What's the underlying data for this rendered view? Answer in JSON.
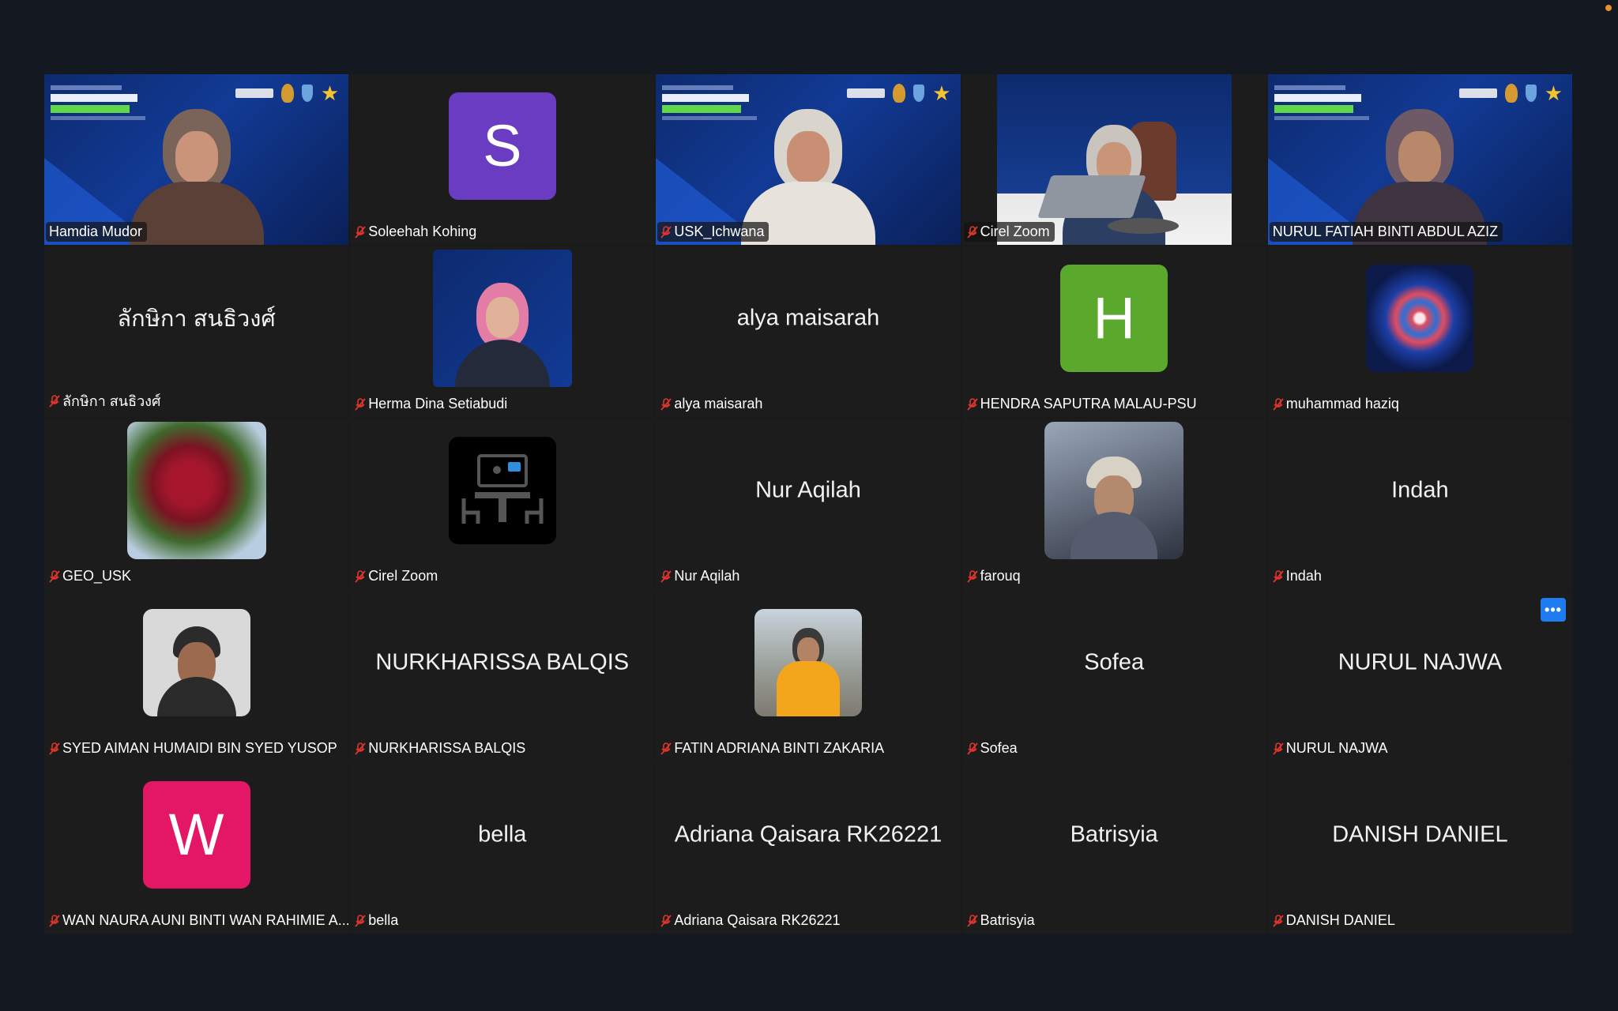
{
  "colors": {
    "active_border": "#23d160",
    "mic_muted": "#e0352b",
    "more_button": "#1e7cf0",
    "avatar_purple": "#6a3cc1",
    "avatar_green": "#5ba92c",
    "avatar_pink": "#e31765"
  },
  "tiles": [
    {
      "label": "Hamdia Mudor"
    },
    {
      "label": "Soleehah Kohing",
      "avatar_letter": "S"
    },
    {
      "label": "USK_Ichwana"
    },
    {
      "label": "Cirel Zoom"
    },
    {
      "label": "NURUL FATIAH BINTI ABDUL AZIZ"
    },
    {
      "label": "ลักษิกา สนธิวงศ์",
      "display_name": "ลักษิกา สนธิวงศ์"
    },
    {
      "label": "Herma Dina Setiabudi"
    },
    {
      "label": "alya maisarah",
      "display_name": "alya maisarah"
    },
    {
      "label": "HENDRA SAPUTRA MALAU-PSU",
      "avatar_letter": "H"
    },
    {
      "label": "muhammad haziq"
    },
    {
      "label": "GEO_USK"
    },
    {
      "label": "Cirel Zoom"
    },
    {
      "label": "Nur Aqilah",
      "display_name": "Nur Aqilah"
    },
    {
      "label": "farouq"
    },
    {
      "label": "Indah",
      "display_name": "Indah"
    },
    {
      "label": "SYED AIMAN HUMAIDI BIN SYED YUSOP"
    },
    {
      "label": "NURKHARISSA BALQIS",
      "display_name": "NURKHARISSA BALQIS"
    },
    {
      "label": "FATIN ADRIANA BINTI ZAKARIA"
    },
    {
      "label": "Sofea",
      "display_name": "Sofea"
    },
    {
      "label": "NURUL NAJWA",
      "display_name": "NURUL NAJWA"
    },
    {
      "label": "WAN NAURA AUNI BINTI WAN RAHIMIE A...",
      "avatar_letter": "W"
    },
    {
      "label": "bella",
      "display_name": "bella"
    },
    {
      "label": "Adriana Qaisara RK26221",
      "display_name": "Adriana Qaisara RK26221"
    },
    {
      "label": "Batrisyia",
      "display_name": "Batrisyia"
    },
    {
      "label": "DANISH DANIEL",
      "display_name": "DANISH DANIEL"
    }
  ],
  "more_button": {
    "label": "•••"
  },
  "icons": {
    "muted_mic": "mic-off-icon",
    "more": "more-options-icon"
  }
}
